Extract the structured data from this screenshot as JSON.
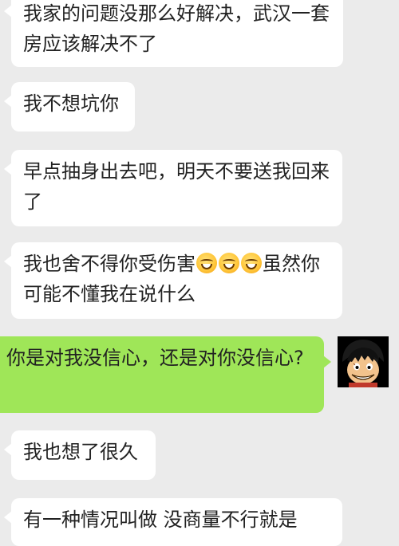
{
  "messages": [
    {
      "side": "in",
      "text": "我家的问题没那么好解决，武汉一套房应该解决不了"
    },
    {
      "side": "in",
      "text": "我不想坑你"
    },
    {
      "side": "in",
      "text": "早点抽身出去吧，明天不要送我回来了"
    },
    {
      "side": "in",
      "text_a": "我也舍不得你受伤害",
      "emoji": [
        "smiling-face",
        "smiling-face",
        "smiling-face"
      ],
      "text_b": "虽然你可能不懂我在说什么"
    },
    {
      "side": "out",
      "text": "你是对我没信心，还是对你没信心?"
    },
    {
      "side": "in",
      "text": "我也想了很久"
    },
    {
      "side": "in",
      "text": "有一种情况叫做 没商量不行就是"
    }
  ],
  "avatar": {
    "icon": "anime-character-avatar"
  },
  "colors": {
    "background": "#ebebeb",
    "incoming_bubble": "#ffffff",
    "outgoing_bubble": "#9fe658",
    "text": "#222222"
  }
}
